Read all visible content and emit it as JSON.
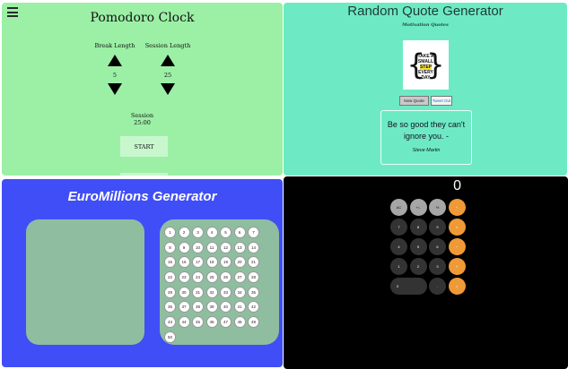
{
  "pomodoro": {
    "title": "Pomodoro Clock",
    "break_label": "Break Length",
    "session_label": "Session Length",
    "break_value": "5",
    "session_value": "25",
    "session_name": "Session",
    "session_time": "25:00",
    "start_label": "START",
    "bg_color": "#9bf0a5"
  },
  "quote": {
    "title": "Random Quote Generator",
    "subtitle": "Motivation Quotes",
    "image_text": [
      "TAKE A",
      "SMALL",
      "STEP",
      "EVERY DAY"
    ],
    "new_quote_label": "New Quote",
    "tweet_label": "Tweet Out",
    "quote_text": "Be so good they can't ignore you. -",
    "quote_author": "Steve Martin",
    "bg_color": "#6deac4"
  },
  "euro": {
    "title": "EuroMillions Generator",
    "numbers": [
      "1",
      "2",
      "3",
      "4",
      "5",
      "6",
      "7",
      "8",
      "9",
      "10",
      "11",
      "12",
      "13",
      "14",
      "15",
      "16",
      "17",
      "18",
      "19",
      "20",
      "21",
      "22",
      "23",
      "24",
      "25",
      "26",
      "27",
      "28",
      "29",
      "30",
      "31",
      "32",
      "33",
      "34",
      "35",
      "36",
      "37",
      "38",
      "39",
      "40",
      "41",
      "42",
      "43",
      "44",
      "45",
      "46",
      "47",
      "48",
      "49",
      "50"
    ],
    "bg_color": "#3f4ef6"
  },
  "calc": {
    "display": "0",
    "keys": [
      {
        "label": "AC",
        "kind": "fn"
      },
      {
        "label": "+/-",
        "kind": "fn"
      },
      {
        "label": "%",
        "kind": "fn"
      },
      {
        "label": "÷",
        "kind": "op"
      },
      {
        "label": "7",
        "kind": "num"
      },
      {
        "label": "8",
        "kind": "num"
      },
      {
        "label": "9",
        "kind": "num"
      },
      {
        "label": "×",
        "kind": "op"
      },
      {
        "label": "4",
        "kind": "num"
      },
      {
        "label": "5",
        "kind": "num"
      },
      {
        "label": "6",
        "kind": "num"
      },
      {
        "label": "−",
        "kind": "op"
      },
      {
        "label": "1",
        "kind": "num"
      },
      {
        "label": "2",
        "kind": "num"
      },
      {
        "label": "3",
        "kind": "num"
      },
      {
        "label": "+",
        "kind": "op"
      },
      {
        "label": "0",
        "kind": "num",
        "wide": true
      },
      {
        "label": ".",
        "kind": "num"
      },
      {
        "label": "=",
        "kind": "op"
      }
    ]
  }
}
